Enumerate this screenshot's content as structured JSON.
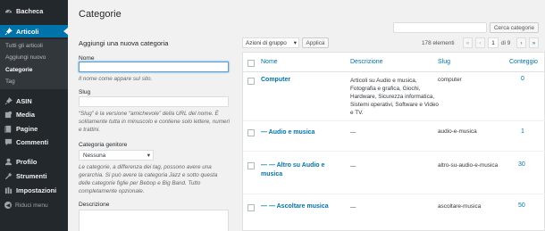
{
  "sidebar": {
    "items": [
      {
        "label": "Bacheca",
        "icon": "dashboard-icon"
      },
      {
        "label": "Articoli",
        "icon": "pin-icon"
      },
      {
        "label": "ASIN",
        "icon": "pin-icon"
      },
      {
        "label": "Media",
        "icon": "media-icon"
      },
      {
        "label": "Pagine",
        "icon": "page-icon"
      },
      {
        "label": "Commenti",
        "icon": "comment-icon"
      },
      {
        "label": "Profilo",
        "icon": "user-icon"
      },
      {
        "label": "Strumenti",
        "icon": "wrench-icon"
      },
      {
        "label": "Impostazioni",
        "icon": "settings-icon"
      }
    ],
    "submenu": [
      "Tutti gli articoli",
      "Aggiungi nuovo",
      "Categorie",
      "Tag"
    ],
    "collapse_label": "Riduci menu"
  },
  "page_title": "Categorie",
  "search_button": "Cerca categorie",
  "form": {
    "heading": "Aggiungi una nuova categoria",
    "name_label": "Nome",
    "name_help": "Il nome come appare sul sito.",
    "slug_label": "Slug",
    "slug_help": "“Slug” è la versione “amichevole” della URL del nome. È solitamente tutta in minuscolo e contiene solo lettere, numeri e trattini.",
    "parent_label": "Categoria genitore",
    "parent_value": "Nessuna",
    "parent_help": "Le categorie, a differenza dei tag, possono avere una gerarchia. Si può avere la categoria Jazz e sotto questa delle categorie figlie per Bebop e Big Band. Tutto completamente opzionale.",
    "desc_label": "Descrizione"
  },
  "bulk": {
    "select_value": "Azioni di gruppo",
    "apply_label": "Applica",
    "count": "178 elementi",
    "first": "«",
    "prev": "‹",
    "page": "1",
    "page_of": "di 9",
    "next": "›",
    "last": "»"
  },
  "table": {
    "headers": {
      "name": "Nome",
      "description": "Descrizione",
      "slug": "Slug",
      "count": "Conteggio"
    },
    "rows": [
      {
        "name": "Computer",
        "description": "Articoli su Audio e musica, Fotografia e grafica, Giochi, Hardware, Sicurezza informatica, Sistemi operativi, Software e Video e TV.",
        "slug": "computer",
        "count": "0"
      },
      {
        "name": "— Audio e musica",
        "description": "—",
        "slug": "audio-e-musica",
        "count": "1"
      },
      {
        "name": "— — Altro su Audio e musica",
        "description": "—",
        "slug": "altro-su-audio-e-musica",
        "count": "30"
      },
      {
        "name": "— — Ascoltare musica",
        "description": "—",
        "slug": "ascoltare-musica",
        "count": "50"
      }
    ]
  }
}
